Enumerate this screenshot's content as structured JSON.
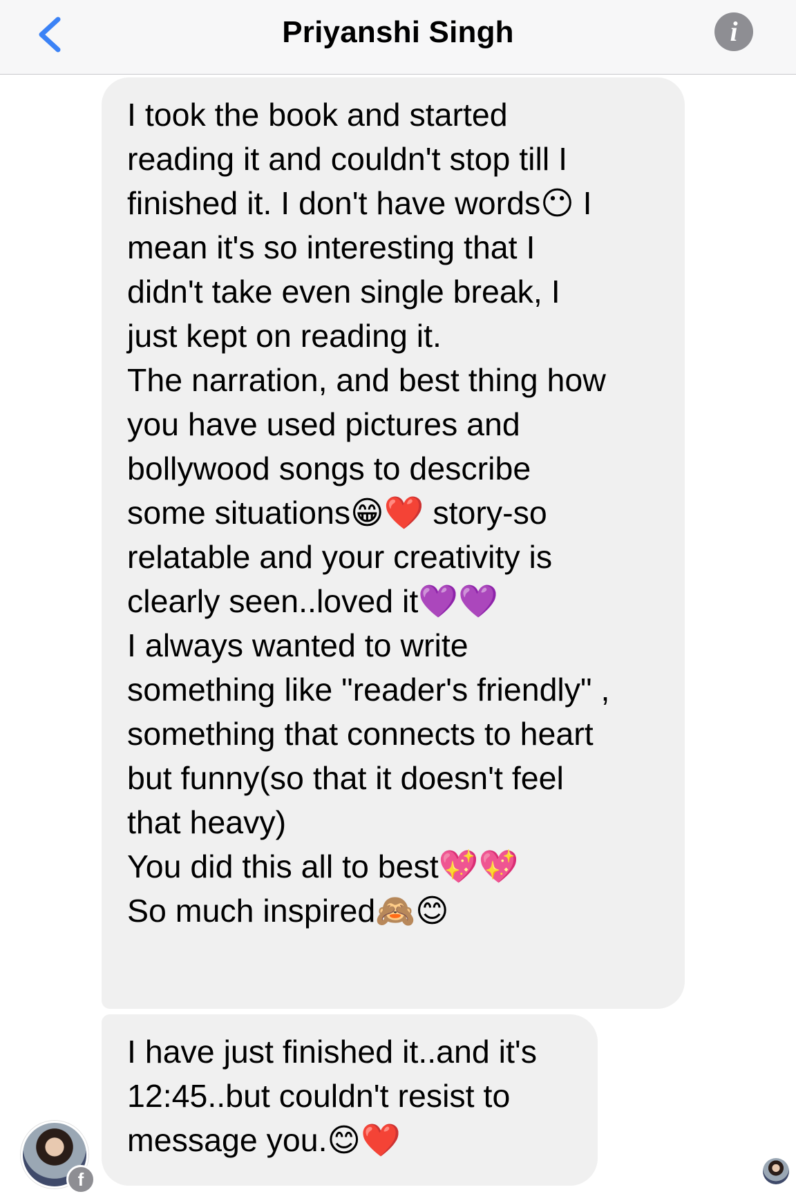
{
  "header": {
    "title": "Priyanshi Singh"
  },
  "colors": {
    "accent": "#3b82f6",
    "bubble": "#f0f0f0",
    "icon_gray": "#8e8e93"
  },
  "icons": {
    "back": "chevron-left-icon",
    "info": "info-icon",
    "facebook": "facebook-icon"
  },
  "info_glyph": "i",
  "fb_glyph": "f",
  "messages": [
    {
      "sender": "Priyanshi Singh",
      "text": "I took the book and started\nreading it and couldn't stop till I\nfinished it. I don't have words😶 I\nmean it's so interesting that I\ndidn't take even single break, I\njust kept on reading it.\nThe narration, and best thing how\nyou have used pictures and\nbollywood songs to describe\nsome situations😁❤️ story-so\nrelatable and your creativity is\nclearly seen..loved it💜💜\nI always wanted to write\nsomething like \"reader's friendly\" ,\nsomething that connects to heart\nbut funny(so that it doesn't feel\nthat heavy)\nYou did this all to best💖💖\nSo much inspired🙈😊"
    },
    {
      "sender": "Priyanshi Singh",
      "text": "I have just finished it..and it's\n12:45..but couldn't resist to\nmessage you.😊❤️"
    }
  ]
}
